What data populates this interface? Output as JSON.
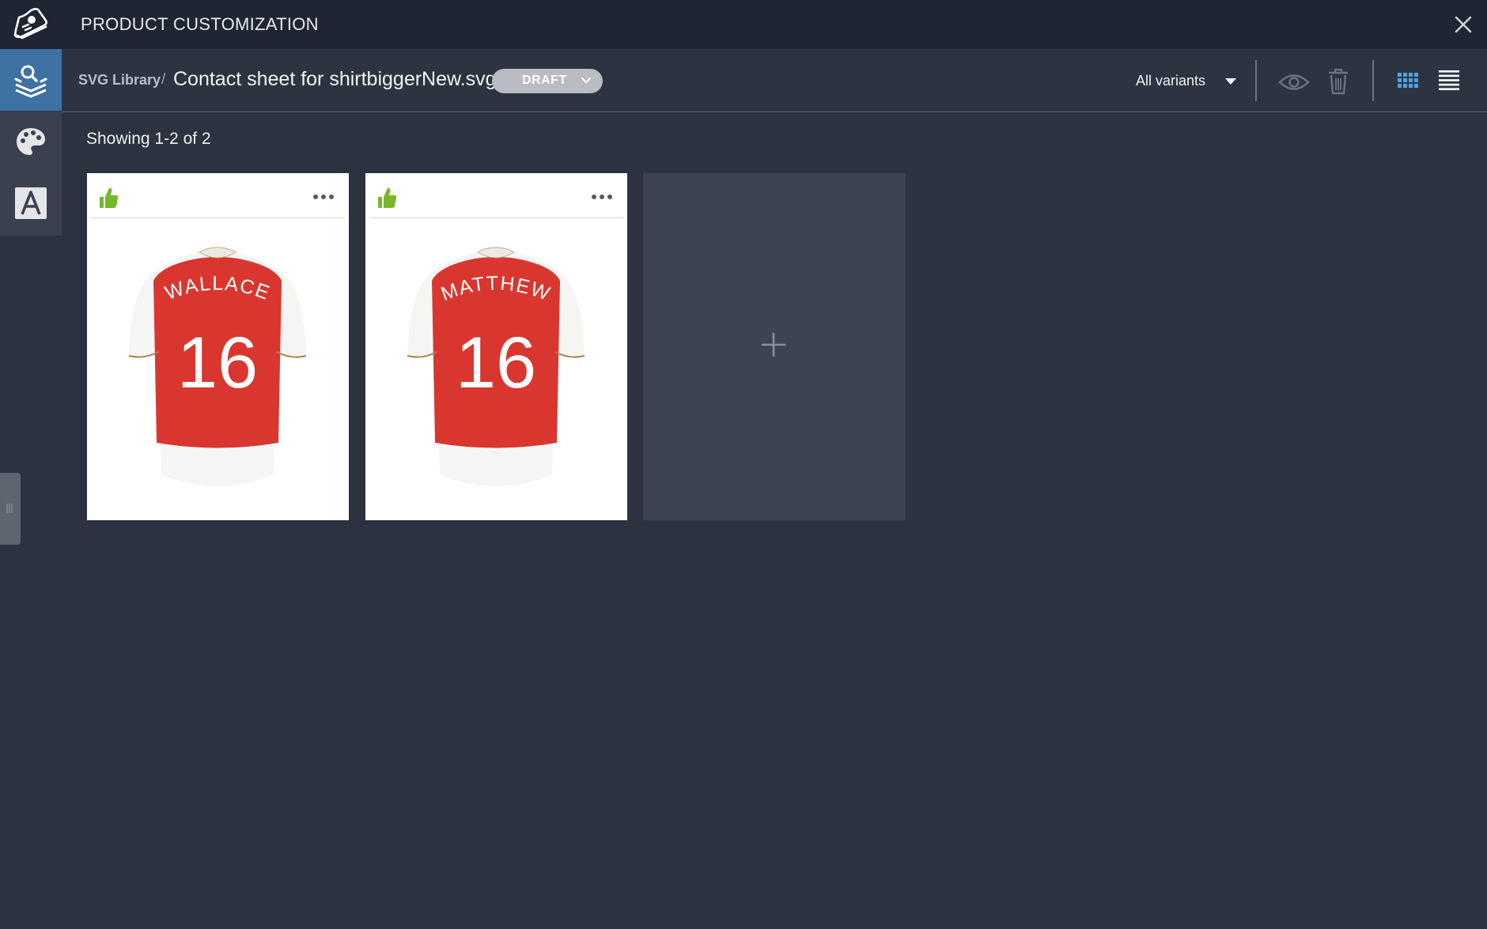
{
  "app": {
    "title": "PRODUCT CUSTOMIZATION",
    "logo_icon": "sneaker-logo-icon",
    "close_icon": "close-icon"
  },
  "rail": {
    "items": [
      {
        "icon": "search-layers-icon",
        "active": true
      },
      {
        "icon": "palette-icon",
        "active": false
      },
      {
        "icon": "text-font-icon",
        "active": false
      }
    ]
  },
  "breadcrumb": {
    "library": "SVG Library",
    "separator": "/",
    "title": "Contact sheet for shirtbiggerNew.svg"
  },
  "status": {
    "label": "DRAFT",
    "icon": "chevron-down-icon"
  },
  "variants": {
    "selected": "All variants"
  },
  "toolbar": {
    "icons": [
      "preview-eye-icon",
      "trash-icon",
      "grid-view-icon",
      "list-view-icon"
    ]
  },
  "results": {
    "summary": "Showing 1-2 of 2"
  },
  "cards": [
    {
      "name": "WALLACE",
      "number": "16",
      "approved": true
    },
    {
      "name": "MATTHEW",
      "number": "16",
      "approved": true
    }
  ],
  "add_card": {
    "icon": "plus-icon"
  },
  "colors": {
    "accent": "#3d72a3",
    "approve": "#78b72a",
    "jersey_red": "#d9362f",
    "grid_icon": "#4aa3e8",
    "background": "#2c3240",
    "topbar": "#1f2532"
  }
}
